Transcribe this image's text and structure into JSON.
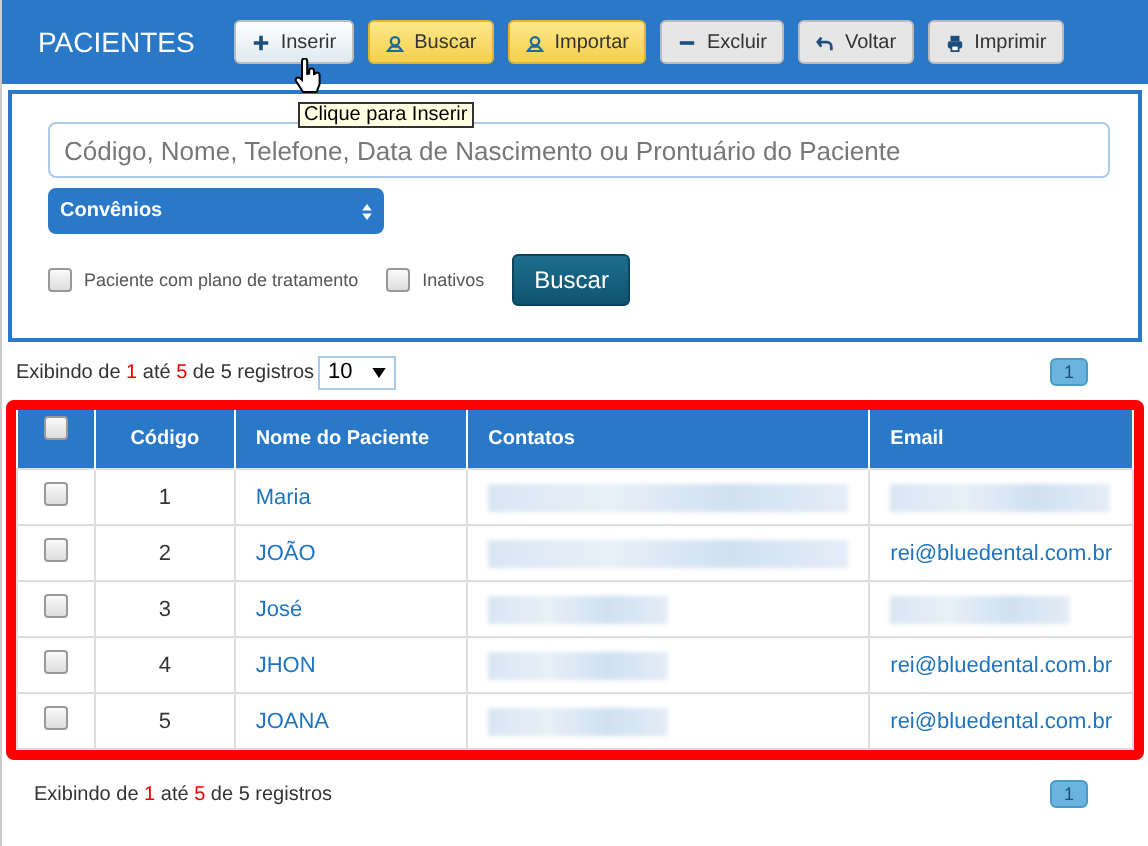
{
  "header": {
    "title": "PACIENTES"
  },
  "toolbar": [
    {
      "label": "Inserir",
      "kind": "default",
      "hovered": true
    },
    {
      "label": "Buscar",
      "kind": "warning",
      "hovered": false
    },
    {
      "label": "Importar",
      "kind": "warning",
      "hovered": false
    },
    {
      "label": "Excluir",
      "kind": "default",
      "hovered": false
    },
    {
      "label": "Voltar",
      "kind": "default",
      "hovered": false
    },
    {
      "label": "Imprimir",
      "kind": "default",
      "hovered": false
    }
  ],
  "tooltip": "Clique para Inserir",
  "search": {
    "placeholder": "Código, Nome, Telefone, Data de Nascimento ou Prontuário do Paciente",
    "select": "Convênios",
    "checks": [
      {
        "label": "Paciente com plano de tratamento",
        "checked": false
      },
      {
        "label": "Inativos",
        "checked": false
      }
    ],
    "button": "Buscar"
  },
  "info_top": {
    "prefix": "Exibindo de",
    "from": "1",
    "mid": "até",
    "to": "5",
    "suffix": "de 5 registros",
    "page_size": "10"
  },
  "pages": [
    {
      "label": "1",
      "selected": true
    }
  ],
  "table": {
    "select_all": false,
    "columns": [
      "Código",
      "Nome do Paciente",
      "Contatos",
      "Email"
    ],
    "rows": [
      {
        "checked": false,
        "code": "1",
        "name": "Maria",
        "email": null
      },
      {
        "checked": false,
        "code": "2",
        "name": "JOÃO",
        "email": "rei@bluedental.com.br"
      },
      {
        "checked": false,
        "code": "3",
        "name": "José",
        "email": null
      },
      {
        "checked": false,
        "code": "4",
        "name": "JHON",
        "email": "rei@bluedental.com.br"
      },
      {
        "checked": false,
        "code": "5",
        "name": "JOANA",
        "email": "rei@bluedental.com.br"
      }
    ]
  },
  "info_bottom": {
    "prefix": "Exibindo de",
    "from": "1",
    "mid": "até",
    "to": "5",
    "suffix": "de 5 registros"
  },
  "pages_bottom": [
    {
      "label": "1",
      "selected": true
    }
  ]
}
